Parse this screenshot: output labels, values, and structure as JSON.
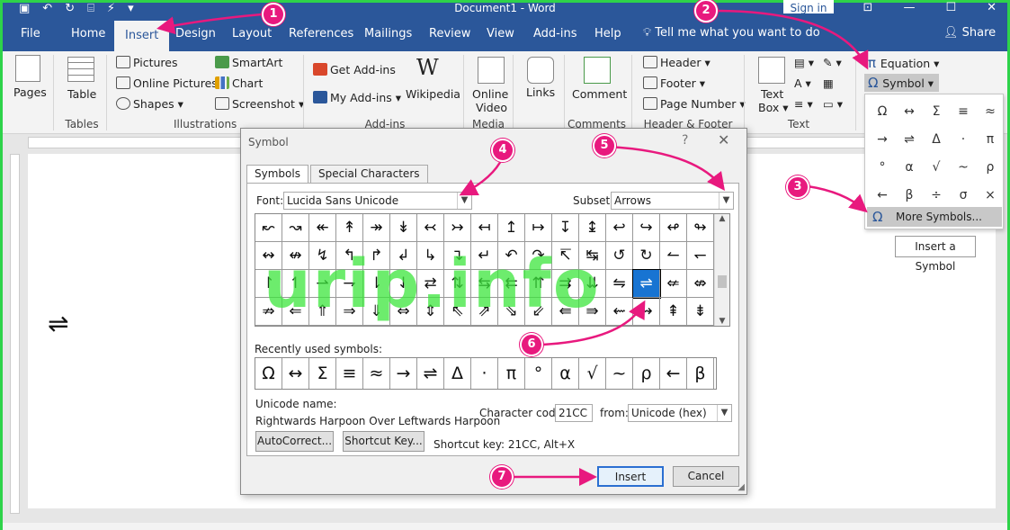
{
  "window": {
    "title": "Document1 - Word",
    "signin": "Sign in"
  },
  "tabs": [
    "File",
    "Home",
    "Insert",
    "Design",
    "Layout",
    "References",
    "Mailings",
    "Review",
    "View",
    "Add-ins",
    "Help"
  ],
  "tellme": "Tell me what you want to do",
  "share": "Share",
  "ribbon": {
    "pages": "Pages",
    "table": "Table",
    "tables_group": "Tables",
    "pictures": "Pictures",
    "online_pictures": "Online Pictures",
    "shapes": "Shapes",
    "smartart": "SmartArt",
    "chart": "Chart",
    "screenshot": "Screenshot",
    "illustrations_group": "Illustrations",
    "get_addins": "Get Add-ins",
    "my_addins": "My Add-ins",
    "wikipedia": "Wikipedia",
    "addins_group": "Add-ins",
    "online_video_1": "Online",
    "online_video_2": "Video",
    "media_group": "Media",
    "links": "Links",
    "comment": "Comment",
    "comments_group": "Comments",
    "header": "Header",
    "footer": "Footer",
    "page_number": "Page Number",
    "header_footer_group": "Header & Footer",
    "textbox_1": "Text",
    "textbox_2": "Box",
    "text_group": "Text",
    "equation": "Equation",
    "symbol": "Symbol"
  },
  "symbol_dropdown": {
    "symbols": [
      "Ω",
      "↔",
      "Σ",
      "≡",
      "≈",
      "→",
      "⇌",
      "Δ",
      "·",
      "π",
      "°",
      "α",
      "√",
      "~",
      "ρ",
      "←",
      "β",
      "÷",
      "σ",
      "×"
    ],
    "more": "More Symbols...",
    "tooltip": "Insert a Symbol"
  },
  "document": {
    "inserted_char": "⇌"
  },
  "dialog": {
    "title": "Symbol",
    "tab_symbols": "Symbols",
    "tab_special": "Special Characters",
    "font_label": "Font:",
    "font_value": "Lucida Sans Unicode",
    "subset_label": "Subset:",
    "subset_value": "Arrows",
    "char_rows": [
      [
        "↜",
        "↝",
        "↞",
        "↟",
        "↠",
        "↡",
        "↢",
        "↣",
        "↤",
        "↥",
        "↦",
        "↧",
        "↨",
        "↩",
        "↪",
        "↫",
        "↬"
      ],
      [
        "↭",
        "↮",
        "↯",
        "↰",
        "↱",
        "↲",
        "↳",
        "↴",
        "↵",
        "↶",
        "↷",
        "↸",
        "↹",
        "↺",
        "↻",
        "↼",
        "↽"
      ],
      [
        "↾",
        "↿",
        "⇀",
        "⇁",
        "⇂",
        "⇃",
        "⇄",
        "⇅",
        "⇆",
        "⇇",
        "⇈",
        "⇉",
        "⇊",
        "⇋",
        "⇌",
        "⇍",
        "⇎"
      ],
      [
        "⇏",
        "⇐",
        "⇑",
        "⇒",
        "⇓",
        "⇔",
        "⇕",
        "⇖",
        "⇗",
        "⇘",
        "⇙",
        "⇚",
        "⇛",
        "⇜",
        "⇝",
        "⇞",
        "⇟"
      ]
    ],
    "selected_char": "⇌",
    "recent_label": "Recently used symbols:",
    "recent": [
      "Ω",
      "↔",
      "Σ",
      "≡",
      "≈",
      "→",
      "⇌",
      "Δ",
      "·",
      "π",
      "°",
      "α",
      "√",
      "~",
      "ρ",
      "←",
      "β"
    ],
    "unicode_name_label": "Unicode name:",
    "unicode_name": "Rightwards Harpoon Over Leftwards Harpoon",
    "char_code_label": "Character code:",
    "char_code": "21CC",
    "from_label": "from:",
    "from_value": "Unicode (hex)",
    "autocorrect": "AutoCorrect...",
    "shortcut_key_btn": "Shortcut Key...",
    "shortcut_text": "Shortcut key: 21CC, Alt+X",
    "insert": "Insert",
    "cancel": "Cancel"
  },
  "watermark": "urip.info",
  "callouts": [
    "1",
    "2",
    "3",
    "4",
    "5",
    "6",
    "7"
  ],
  "colors": {
    "brand": "#2b579a",
    "callout": "#e8197e",
    "selection": "#1874d2"
  }
}
